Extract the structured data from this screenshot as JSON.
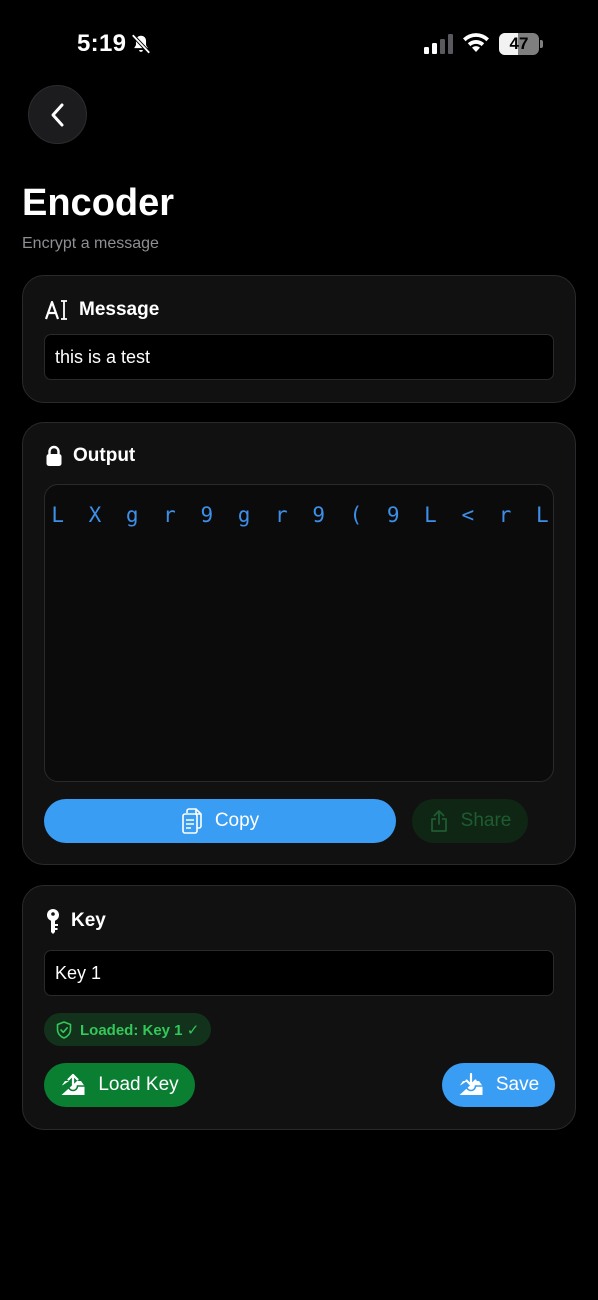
{
  "status_bar": {
    "time": "5:19",
    "battery_level": "47",
    "battery_percent": 47,
    "signal_bars": 2
  },
  "header": {
    "back_icon": "chevron-left-icon",
    "title": "Encoder",
    "subtitle": "Encrypt a message"
  },
  "message_card": {
    "icon": "text-cursor-icon",
    "label": "Message",
    "value": "this is a test"
  },
  "output_card": {
    "icon": "lock-icon",
    "label": "Output",
    "output_text": "L X g r 9 g r 9 ( 9 L < r L",
    "copy_label": "Copy",
    "copy_icon": "copy-icon",
    "share_label": "Share",
    "share_icon": "share-icon"
  },
  "key_card": {
    "icon": "key-icon",
    "label": "Key",
    "value": "Key 1",
    "badge_text": "Loaded: Key 1 ✓",
    "badge_icon": "shield-check-icon",
    "load_label": "Load Key",
    "load_icon": "tray-upload-icon",
    "save_label": "Save",
    "save_icon": "tray-download-icon"
  },
  "colors": {
    "accent_blue": "#3a9df4",
    "accent_green": "#0a7f32",
    "output_text": "#3d8fe8",
    "badge_green": "#34c759",
    "background": "#000000",
    "card": "#111112"
  }
}
